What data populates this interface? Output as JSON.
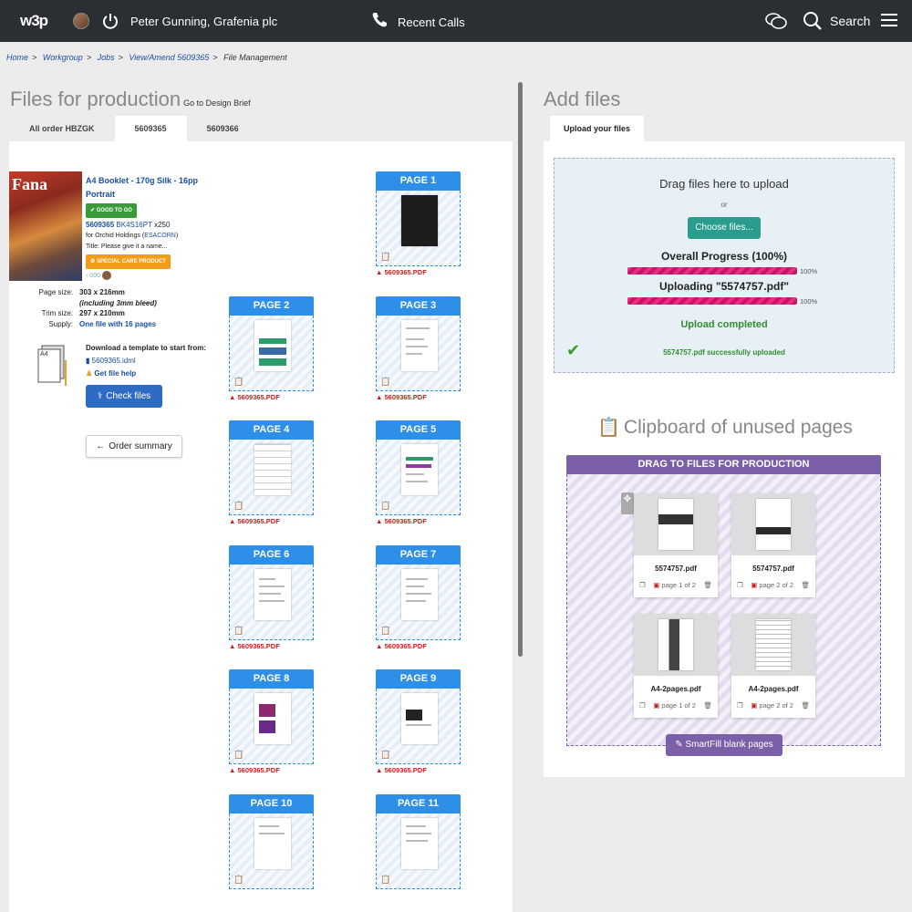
{
  "topbar": {
    "logo": "w3p",
    "user": "Peter Gunning, Grafenia plc",
    "recent_calls": "Recent Calls",
    "search": "Search"
  },
  "breadcrumb": [
    "Home",
    "Workgroup",
    "Jobs",
    "View/Amend 5609365",
    "File Management"
  ],
  "left": {
    "title": "Files for production",
    "design_brief": "Go to Design Brief",
    "tabs": [
      "All order HBZGK",
      "5609365",
      "5609366"
    ],
    "active_tab": 1,
    "cover_text": "Fana",
    "product_name": "A4 Booklet - 170g Silk - 16pp",
    "orientation": "Portrait",
    "badge_good": "GOOD TO GO",
    "job_number": "5609365",
    "job_code": "BK4S16PT",
    "job_qty": "x250",
    "for_label": "for Orchid Holdings (",
    "for_code": "ESACORN",
    "for_close": ")",
    "title_line": "Title: Please give it a name...",
    "badge_special": "SPECIAL CARE PRODUCT",
    "counter": "000",
    "specs": [
      {
        "k": "Page size:",
        "v": "303 x 216mm"
      },
      {
        "k": "",
        "v": "(including 3mm bleed)"
      },
      {
        "k": "Trim size:",
        "v": "297 x 210mm"
      },
      {
        "k": "Supply:",
        "v": "One file with 16 pages"
      }
    ],
    "a4_label": "A4",
    "download_label": "Download a template to start from:",
    "idml_file": "5609365.idml",
    "file_help": "Get file help",
    "check_files": "Check files",
    "order_summary": "Order summary"
  },
  "pages": [
    {
      "label": "PAGE 1",
      "file": "5609365.PDF"
    },
    {
      "label": "PAGE 2",
      "file": "5609365.PDF"
    },
    {
      "label": "PAGE 3",
      "file": "5609365.PDF"
    },
    {
      "label": "PAGE 4",
      "file": "5609365.PDF"
    },
    {
      "label": "PAGE 5",
      "file": "5609365.PDF"
    },
    {
      "label": "PAGE 6",
      "file": "5609365.PDF"
    },
    {
      "label": "PAGE 7",
      "file": "5609365.PDF"
    },
    {
      "label": "PAGE 8",
      "file": "5609365.PDF"
    },
    {
      "label": "PAGE 9",
      "file": "5609365.PDF"
    },
    {
      "label": "PAGE 10",
      "file": ""
    },
    {
      "label": "PAGE 11",
      "file": ""
    }
  ],
  "right": {
    "title": "Add files",
    "upload_tab": "Upload your files",
    "drag_text": "Drag files here to upload",
    "or": "or",
    "choose": "Choose files...",
    "overall": "Overall Progress (100%)",
    "overall_pct": "100%",
    "overall_value": 1.0,
    "uploading": "Uploading \"5574757.pdf\"",
    "uploading_pct": "100%",
    "uploading_value": 1.0,
    "completed": "Upload completed",
    "success": "5574757.pdf successfully uploaded",
    "clipboard_title": "Clipboard of unused pages",
    "drag_header": "DRAG TO FILES FOR PRODUCTION",
    "smartfill": "SmartFill blank pages",
    "cards": [
      {
        "file": "5574757.pdf",
        "page": "page 1 of 2"
      },
      {
        "file": "5574757.pdf",
        "page": "page 2 of 2"
      },
      {
        "file": "A4-2pages.pdf",
        "page": "page 1 of 2"
      },
      {
        "file": "A4-2pages.pdf",
        "page": "page 2 of 2"
      }
    ]
  },
  "colors": {
    "topbar": "#2b2e33",
    "page_header": "#2e8fe8",
    "clipboard": "#7b5fa8",
    "progress": "#e0327e",
    "success": "#2f8f2f"
  }
}
